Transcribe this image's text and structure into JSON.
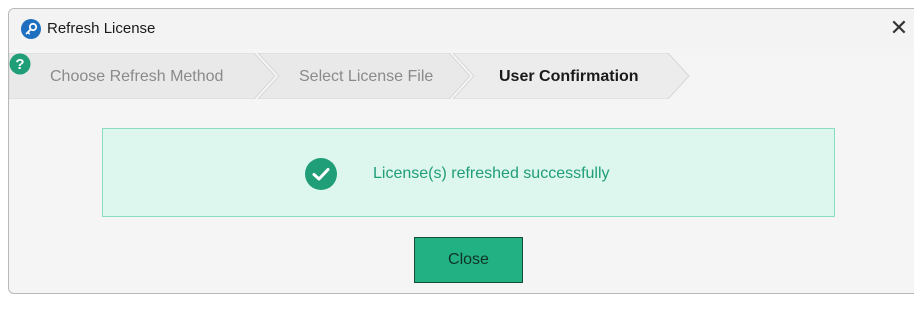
{
  "window": {
    "title": "Refresh License",
    "close_symbol": "✕",
    "title_icon": "key-icon"
  },
  "wizard": {
    "steps": [
      {
        "label": "Choose Refresh Method",
        "active": false
      },
      {
        "label": "Select License File",
        "active": false
      },
      {
        "label": "User Confirmation",
        "active": true
      }
    ],
    "help_icon": "help-icon"
  },
  "banner": {
    "message": "License(s) refreshed successfully",
    "icon": "check-circle-icon"
  },
  "actions": {
    "close_label": "Close"
  },
  "colors": {
    "accent": "#1e88c8",
    "success_text": "#1f9e77",
    "success_bg": "#ddf6ee",
    "success_border": "#8cdcc0",
    "button_bg": "#21b183",
    "help_icon": "#1f9e77"
  }
}
